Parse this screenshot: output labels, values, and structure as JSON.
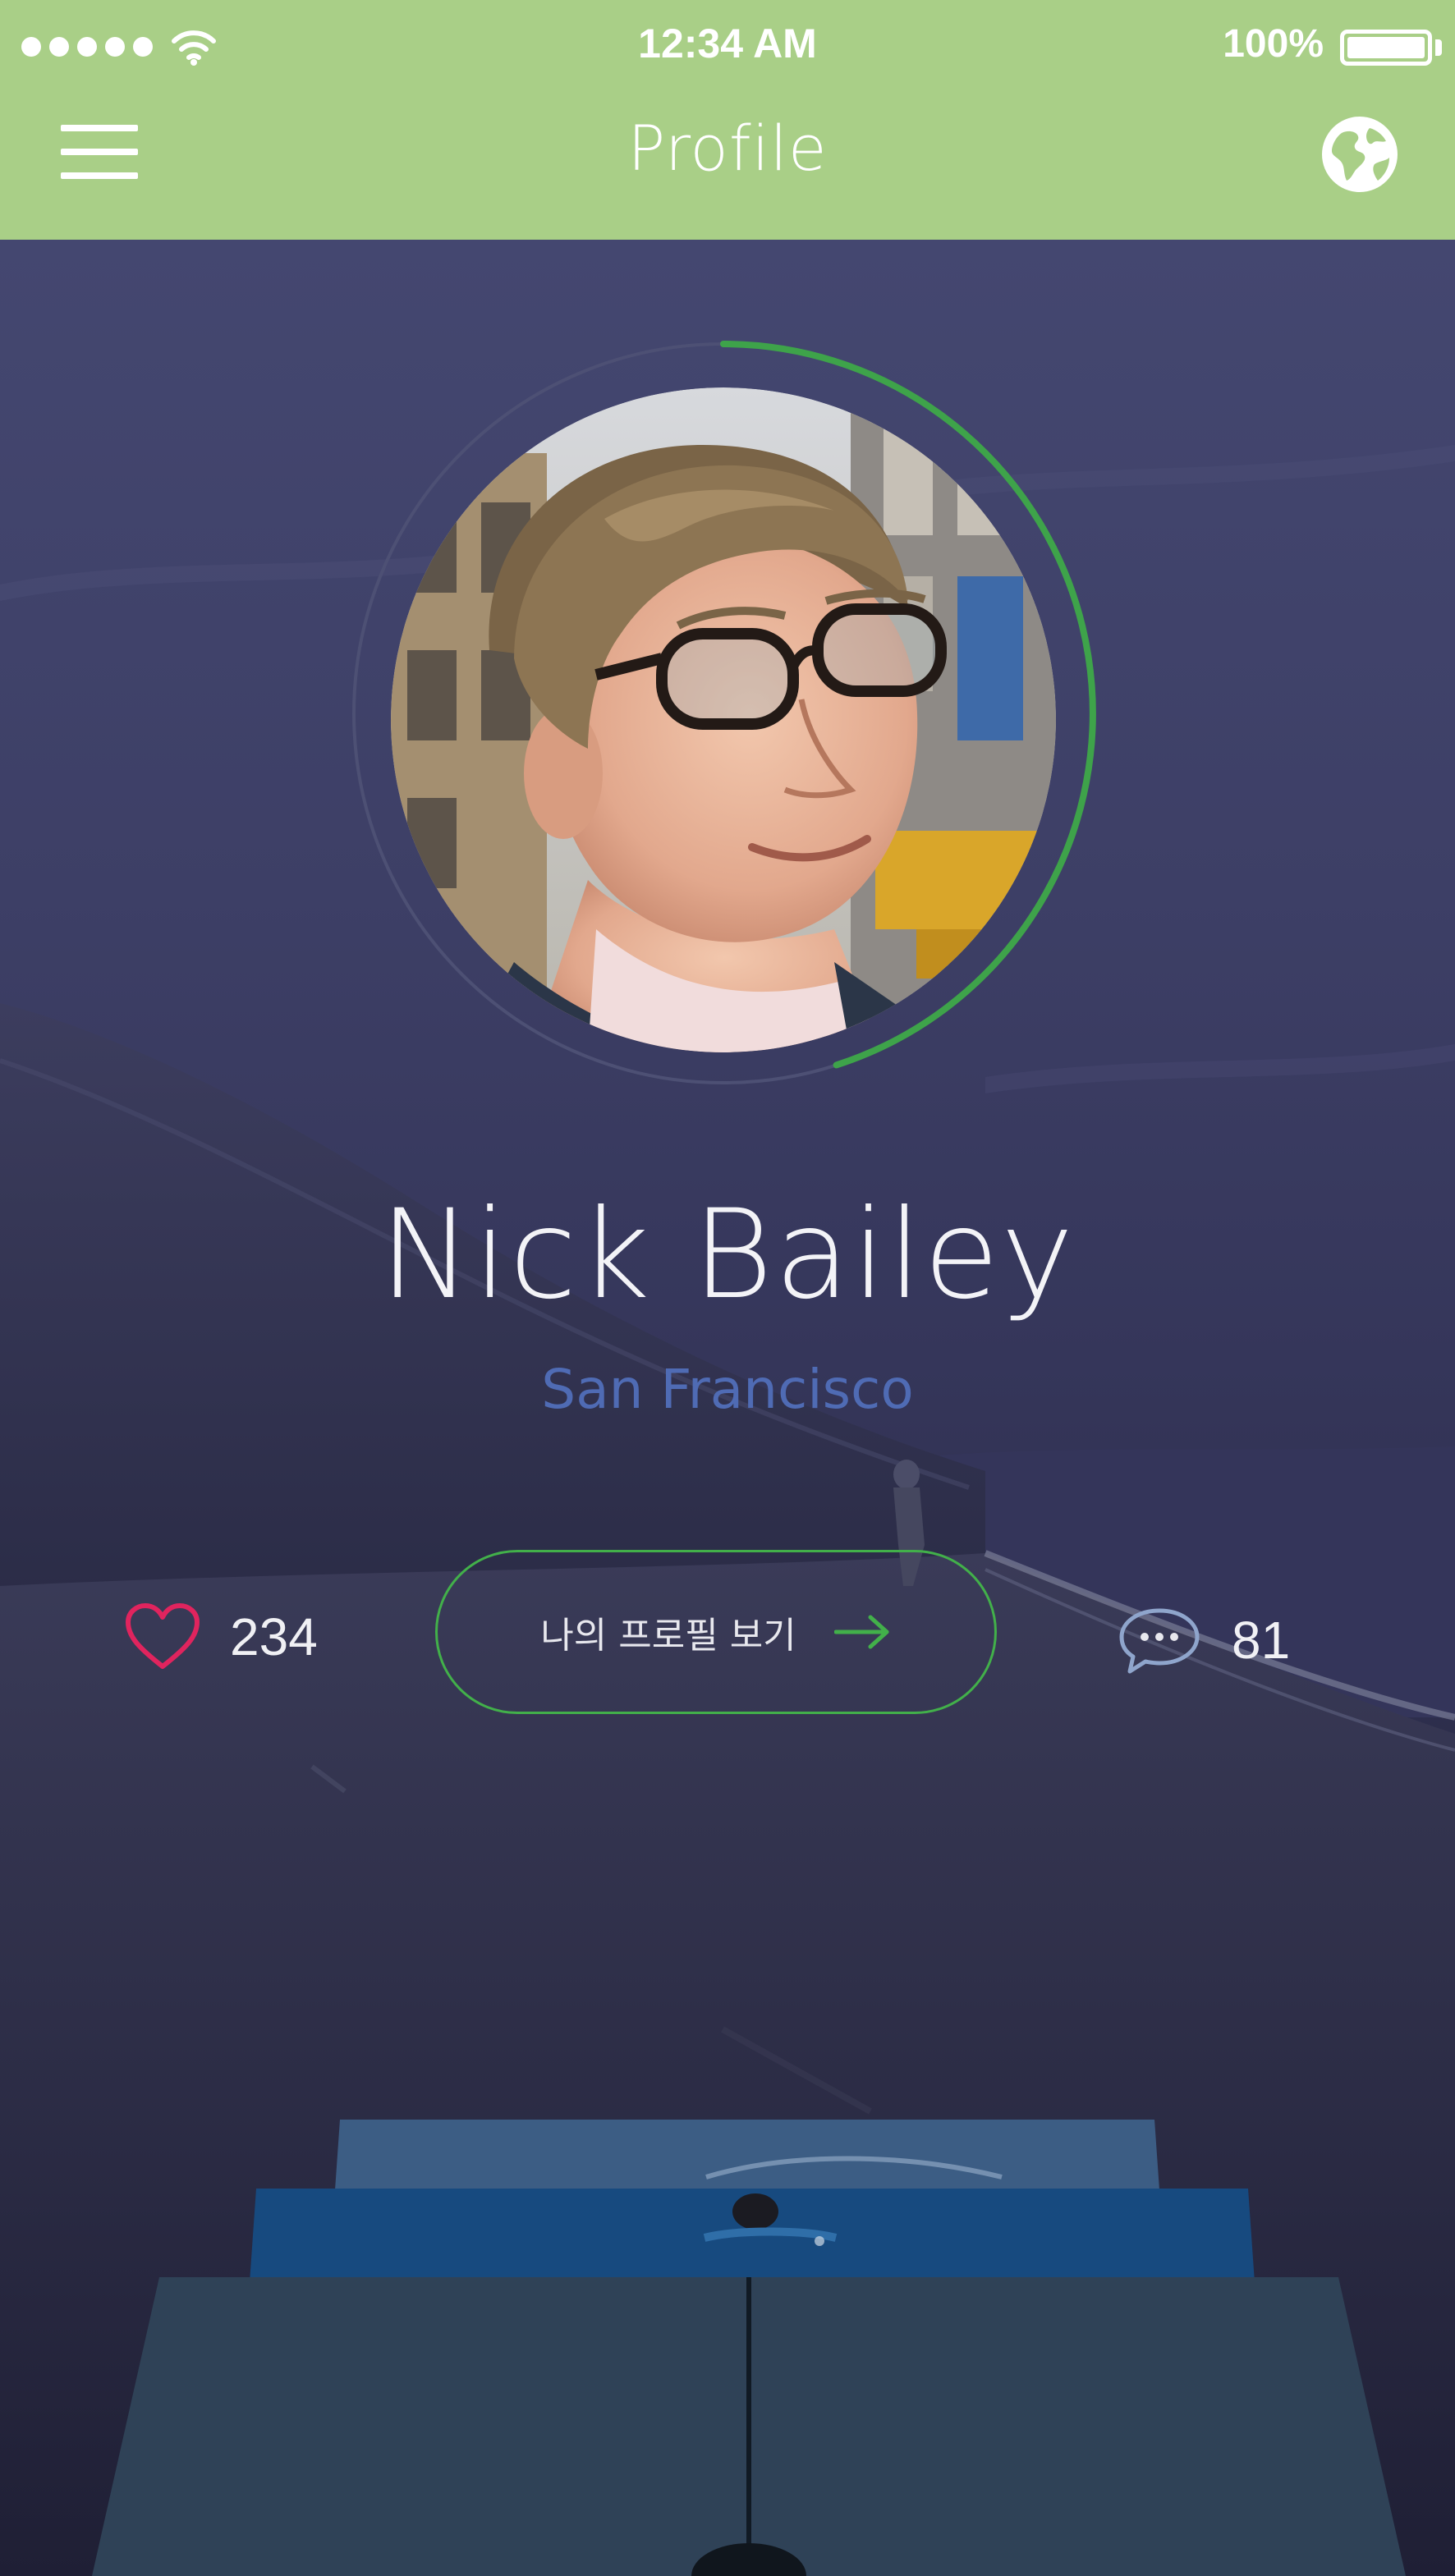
{
  "status_bar": {
    "time": "12:34 AM",
    "battery": "100%",
    "signal_icon": "signal-dots-icon",
    "wifi_icon": "wifi-icon",
    "battery_icon": "battery-icon"
  },
  "nav": {
    "title": "Profile",
    "menu_icon": "hamburger-menu-icon",
    "globe_icon": "globe-icon",
    "bar_color": "#a9cf87"
  },
  "profile": {
    "name": "Nick Bailey",
    "location": "San Francisco",
    "progress_fraction": 0.45,
    "likes": {
      "count": "234",
      "icon": "heart-icon",
      "color": "#e0245e"
    },
    "comments": {
      "count": "81",
      "icon": "speech-bubble-icon"
    },
    "view_profile_button": {
      "label": "나의 프로필 보기",
      "icon": "arrow-right-icon",
      "color": "#42b04a"
    }
  },
  "colors": {
    "accent_green": "#42b04a",
    "location_blue": "#4f6bb4"
  }
}
